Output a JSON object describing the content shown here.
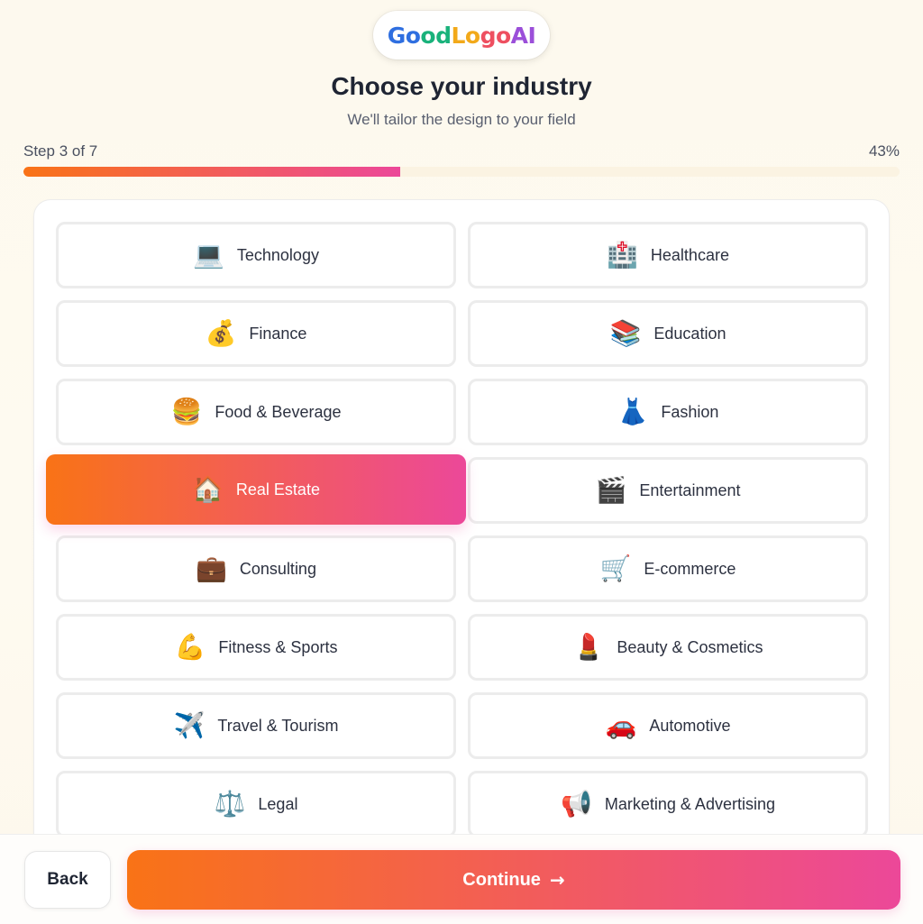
{
  "logo": {
    "parts": [
      "Go",
      "od",
      "Lo",
      "go",
      "AI"
    ]
  },
  "header": {
    "title": "Choose your industry",
    "subtitle": "We'll tailor the design to your field"
  },
  "progress": {
    "step_label": "Step 3 of 7",
    "percent_label": "43%",
    "percent": 43
  },
  "options": [
    {
      "label": "Technology",
      "emoji": "💻",
      "selected": false
    },
    {
      "label": "Healthcare",
      "emoji": "🏥",
      "selected": false
    },
    {
      "label": "Finance",
      "emoji": "💰",
      "selected": false
    },
    {
      "label": "Education",
      "emoji": "📚",
      "selected": false
    },
    {
      "label": "Food & Beverage",
      "emoji": "🍔",
      "selected": false
    },
    {
      "label": "Fashion",
      "emoji": "👗",
      "selected": false
    },
    {
      "label": "Real Estate",
      "emoji": "🏠",
      "selected": true
    },
    {
      "label": "Entertainment",
      "emoji": "🎬",
      "selected": false
    },
    {
      "label": "Consulting",
      "emoji": "💼",
      "selected": false
    },
    {
      "label": "E-commerce",
      "emoji": "🛒",
      "selected": false
    },
    {
      "label": "Fitness & Sports",
      "emoji": "💪",
      "selected": false
    },
    {
      "label": "Beauty & Cosmetics",
      "emoji": "💄",
      "selected": false
    },
    {
      "label": "Travel & Tourism",
      "emoji": "✈️",
      "selected": false
    },
    {
      "label": "Automotive",
      "emoji": "🚗",
      "selected": false
    },
    {
      "label": "Legal",
      "emoji": "⚖️",
      "selected": false
    },
    {
      "label": "Marketing & Advertising",
      "emoji": "📢",
      "selected": false
    }
  ],
  "footer": {
    "back_label": "Back",
    "continue_label": "Continue",
    "continue_icon": "arrow-right-icon"
  },
  "colors": {
    "gradient_start": "#f97316",
    "gradient_end": "#ec4899"
  }
}
